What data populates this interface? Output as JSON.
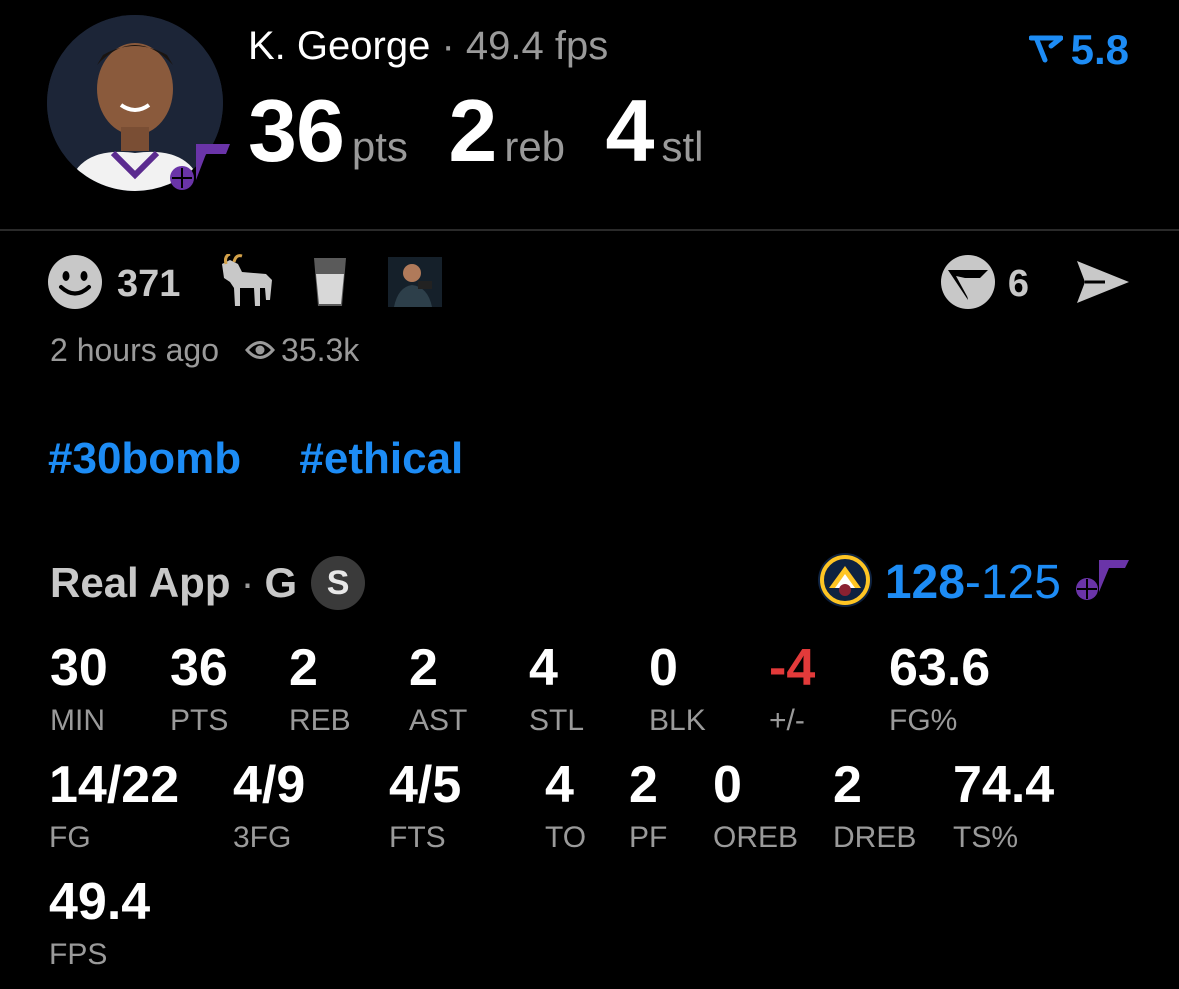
{
  "player": {
    "name": "K. George",
    "separator": "·",
    "fps_label": "49.4 fps",
    "rating": "5.8"
  },
  "statline": [
    {
      "value": "36",
      "unit": "pts"
    },
    {
      "value": "2",
      "unit": "reb"
    },
    {
      "value": "4",
      "unit": "stl"
    }
  ],
  "reactions": {
    "smiley_count": "371",
    "comment_count": "6"
  },
  "meta": {
    "time": "2 hours ago",
    "views": "35.3k"
  },
  "tags": [
    "#30bomb",
    "#ethical"
  ],
  "game": {
    "app": "Real App",
    "separator": "·",
    "position": "G",
    "badge": "S",
    "score_win": "128",
    "score_dash": "-",
    "score_loss": "125"
  },
  "stats_row1": [
    {
      "value": "30",
      "label": "MIN"
    },
    {
      "value": "36",
      "label": "PTS"
    },
    {
      "value": "2",
      "label": "REB"
    },
    {
      "value": "2",
      "label": "AST"
    },
    {
      "value": "4",
      "label": "STL"
    },
    {
      "value": "0",
      "label": "BLK"
    },
    {
      "value": "-4",
      "label": "+/-"
    },
    {
      "value": "63.6",
      "label": "FG%"
    }
  ],
  "stats_row2": [
    {
      "value": "14/22",
      "label": "FG"
    },
    {
      "value": "4/9",
      "label": "3FG"
    },
    {
      "value": "4/5",
      "label": "FTS"
    },
    {
      "value": "4",
      "label": "TO"
    },
    {
      "value": "2",
      "label": "PF"
    },
    {
      "value": "0",
      "label": "OREB"
    },
    {
      "value": "2",
      "label": "DREB"
    },
    {
      "value": "74.4",
      "label": "TS%"
    }
  ],
  "stats_row3": [
    {
      "value": "49.4",
      "label": "FPS"
    }
  ],
  "colors": {
    "accent": "#1d8cf5",
    "negative": "#e23a3a",
    "muted": "#9a9a9a",
    "team_purple": "#5b2b8f"
  },
  "icons": {
    "rating": "rating-arrow-icon",
    "smiley": "smiley-icon",
    "goat": "goat-icon",
    "glass": "glass-icon",
    "comment": "comment-icon",
    "share": "send-icon",
    "views": "eye-icon",
    "team": "nuggets-logo-icon",
    "team2": "jazz-note-icon"
  }
}
